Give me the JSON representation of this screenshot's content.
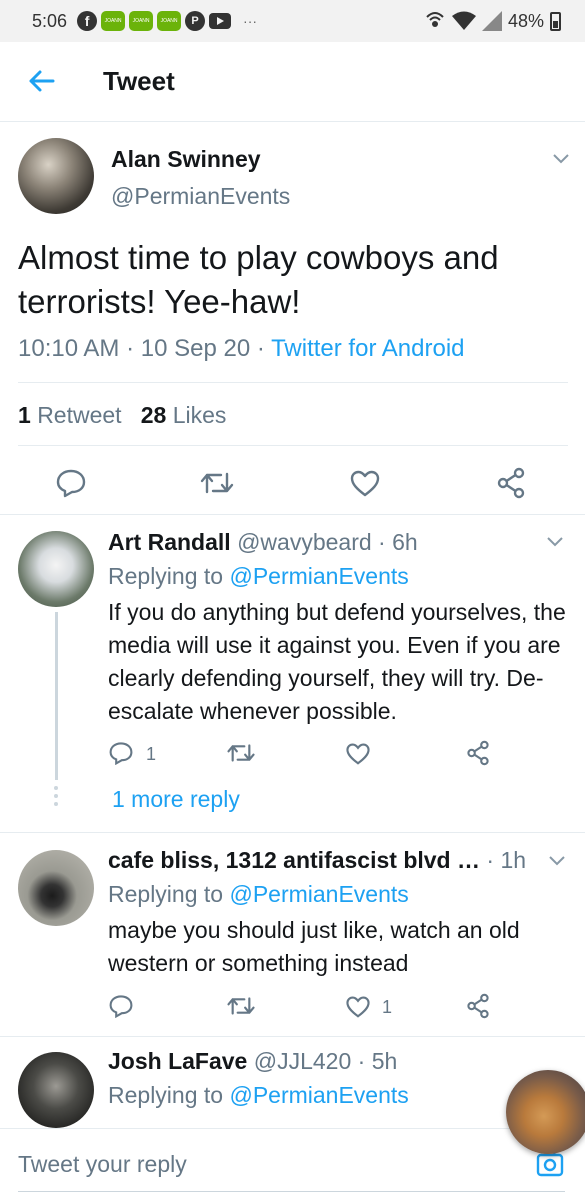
{
  "status_bar": {
    "time": "5:06",
    "battery": "48%",
    "notif_label": "JOANN",
    "more": "···"
  },
  "header": {
    "title": "Tweet"
  },
  "tweet": {
    "author_name": "Alan Swinney",
    "author_handle": "@PermianEvents",
    "text": "Almost time to play cowboys and terrorists! Yee-haw!",
    "time": "10:10 AM",
    "date": "10 Sep 20",
    "source": "Twitter for Android",
    "retweet_count": "1",
    "retweet_label": "Retweet",
    "like_count": "28",
    "like_label": "Likes"
  },
  "replies": [
    {
      "name": "Art Randall",
      "handle": "@wavybeard",
      "age": "6h",
      "replying_prefix": "Replying to",
      "replying_to": "@PermianEvents",
      "text": "If you do anything but defend yourselves, the media will use it against you. Even if you are clearly defending yourself, they will try. De-escalate whenever possible.",
      "reply_count": "1",
      "retweet_count": "",
      "like_count": "",
      "more_replies": "1 more reply"
    },
    {
      "name": "cafe bliss, 1312 antifascist blvd …",
      "handle": "",
      "age": "1h",
      "replying_prefix": "Replying to",
      "replying_to": "@PermianEvents",
      "text": "maybe you should just like, watch an old western or something instead",
      "reply_count": "",
      "retweet_count": "",
      "like_count": "1"
    },
    {
      "name": "Josh LaFave",
      "handle": "@JJL420",
      "age": "5h",
      "replying_prefix": "Replying to",
      "replying_to": "@PermianEvents"
    }
  ],
  "compose": {
    "placeholder": "Tweet your reply"
  },
  "colors": {
    "accent": "#1da1f2",
    "secondary_text": "#657786",
    "divider": "#e6ecf0"
  }
}
